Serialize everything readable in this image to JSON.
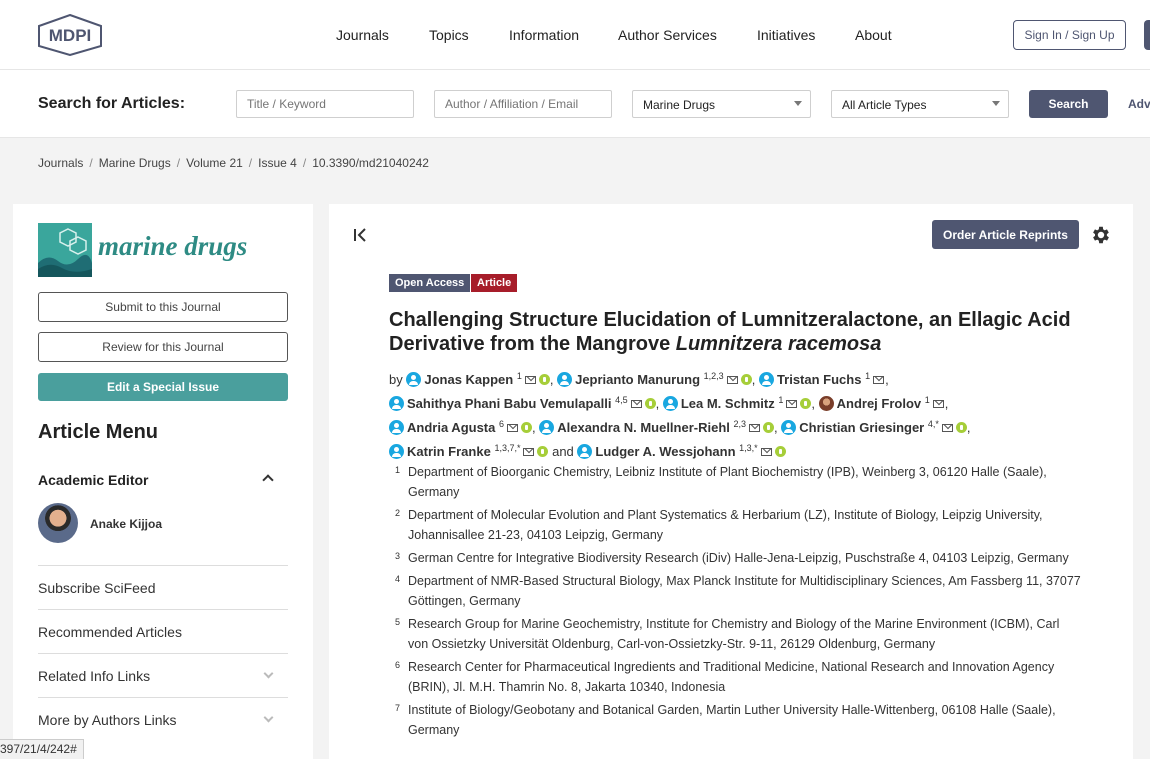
{
  "header": {
    "logo_text": "MDPI",
    "nav": [
      "Journals",
      "Topics",
      "Information",
      "Author Services",
      "Initiatives",
      "About"
    ],
    "signin_label": "Sign In / Sign Up"
  },
  "search": {
    "label": "Search for Articles:",
    "title_placeholder": "Title / Keyword",
    "author_placeholder": "Author / Affiliation / Email",
    "journal_value": "Marine Drugs",
    "type_value": "All Article Types",
    "button_label": "Search",
    "advanced_label": "Adv"
  },
  "breadcrumb": [
    "Journals",
    "Marine Drugs",
    "Volume 21",
    "Issue 4",
    "10.3390/md21040242"
  ],
  "sidebar": {
    "journal_name": "marine drugs",
    "submit_label": "Submit to this Journal",
    "review_label": "Review for this Journal",
    "special_issue_label": "Edit a Special Issue",
    "menu_title": "Article Menu",
    "academic_editor_label": "Academic Editor",
    "editor_name": "Anake Kijjoa",
    "items": [
      "Subscribe SciFeed",
      "Recommended Articles",
      "Related Info Links",
      "More by Authors Links"
    ],
    "status_url": "397/21/4/242#"
  },
  "article": {
    "reprints_label": "Order Article Reprints",
    "badge_open_access": "Open Access",
    "badge_type": "Article",
    "title_main": "Challenging Structure Elucidation of Lumnitzeralactone, an Ellagic Acid Derivative from the Mangrove ",
    "title_italic": "Lumnitzera racemosa",
    "by": "by",
    "and": "and",
    "authors": [
      {
        "name": "Jonas Kappen",
        "sup": "1"
      },
      {
        "name": "Jeprianto Manurung",
        "sup": "1,2,3"
      },
      {
        "name": "Tristan Fuchs",
        "sup": "1"
      },
      {
        "name": "Sahithya Phani Babu Vemulapalli",
        "sup": "4,5"
      },
      {
        "name": "Lea M. Schmitz",
        "sup": "1"
      },
      {
        "name": "Andrej Frolov",
        "sup": "1"
      },
      {
        "name": "Andria Agusta",
        "sup": "6"
      },
      {
        "name": "Alexandra N. Muellner-Riehl",
        "sup": "2,3"
      },
      {
        "name": "Christian Griesinger",
        "sup": "4,*"
      },
      {
        "name": "Katrin Franke",
        "sup": "1,3,7,*"
      },
      {
        "name": "Ludger A. Wessjohann",
        "sup": "1,3,*"
      }
    ],
    "affiliations": [
      {
        "num": "1",
        "text": "Department of Bioorganic Chemistry, Leibniz Institute of Plant Biochemistry (IPB), Weinberg 3, 06120 Halle (Saale), Germany"
      },
      {
        "num": "2",
        "text": "Department of Molecular Evolution and Plant Systematics & Herbarium (LZ), Institute of Biology, Leipzig University, Johannisallee 21-23, 04103 Leipzig, Germany"
      },
      {
        "num": "3",
        "text": "German Centre for Integrative Biodiversity Research (iDiv) Halle-Jena-Leipzig, Puschstraße 4, 04103 Leipzig, Germany"
      },
      {
        "num": "4",
        "text": "Department of NMR-Based Structural Biology, Max Planck Institute for Multidisciplinary Sciences, Am Fassberg 11, 37077 Göttingen, Germany"
      },
      {
        "num": "5",
        "text": "Research Group for Marine Geochemistry, Institute for Chemistry and Biology of the Marine Environment (ICBM), Carl von Ossietzky Universität Oldenburg, Carl-von-Ossietzky-Str. 9-11, 26129 Oldenburg, Germany"
      },
      {
        "num": "6",
        "text": "Research Center for Pharmaceutical Ingredients and Traditional Medicine, National Research and Innovation Agency (BRIN), Jl. M.H. Thamrin No. 8, Jakarta 10340, Indonesia"
      },
      {
        "num": "7",
        "text": "Institute of Biology/Geobotany and Botanical Garden, Martin Luther University Halle-Wittenberg, 06108 Halle (Saale), Germany"
      }
    ]
  },
  "colors": {
    "accent": "#4f5671",
    "teal": "#4a9f9d",
    "article_badge": "#a71d2a",
    "author_icon": "#19a7e0",
    "orcid": "#a6ce39"
  }
}
